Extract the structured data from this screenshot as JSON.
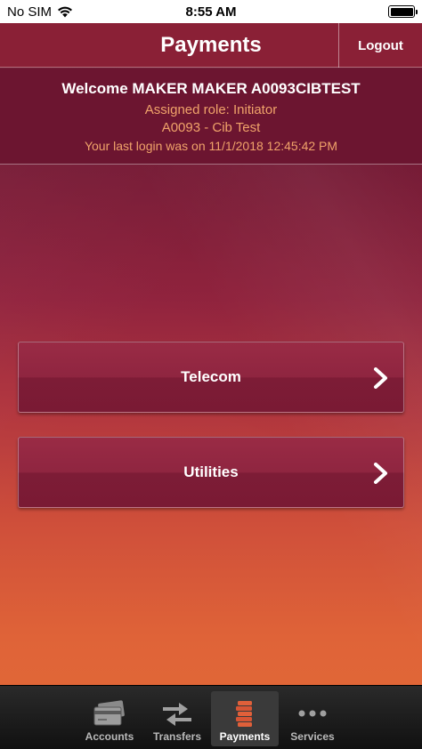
{
  "status_bar": {
    "carrier": "No SIM",
    "time": "8:55 AM"
  },
  "header": {
    "title": "Payments",
    "logout_label": "Logout"
  },
  "welcome": {
    "greeting": "Welcome MAKER MAKER A0093CIBTEST",
    "role": "Assigned role: Initiator",
    "company": "A0093 - Cib Test",
    "last_login": "Your last login was on 11/1/2018 12:45:42 PM"
  },
  "menu": {
    "items": [
      {
        "label": "Telecom"
      },
      {
        "label": "Utilities"
      }
    ]
  },
  "tab_bar": {
    "items": [
      {
        "label": "Accounts",
        "icon": "credit-card-icon"
      },
      {
        "label": "Transfers",
        "icon": "transfer-arrows-icon"
      },
      {
        "label": "Payments",
        "icon": "coin-stack-icon",
        "active": true
      },
      {
        "label": "Services",
        "icon": "more-dots-icon"
      }
    ]
  },
  "colors": {
    "accent_text": "#f0a36a",
    "header_bg": "#8a2036",
    "active_icon": "#e0603a"
  }
}
